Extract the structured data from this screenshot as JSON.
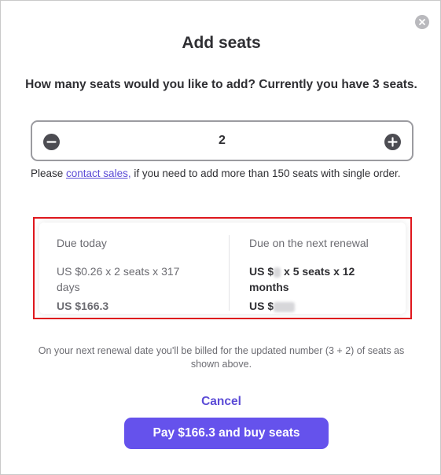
{
  "dialog": {
    "title": "Add seats",
    "question": "How many seats would you like to add? Currently you have 3 seats.",
    "stepper": {
      "value": "2"
    },
    "note": {
      "prefix": "Please ",
      "link": "contact sales,",
      "suffix": " if you need to add more than 150 seats with single order."
    },
    "summary": {
      "due_today": {
        "heading": "Due today",
        "calculation": "US $0.26 x 2 seats x 317 days",
        "total": "US $166.3"
      },
      "next_renewal": {
        "heading": "Due on the next renewal",
        "calc_prefix": "US $",
        "calc_suffix": " x 5 seats x 12 months",
        "total_prefix": "US $"
      }
    },
    "billing_note": "On your next renewal date you'll be billed for the updated number (3 + 2) of seats as shown above.",
    "cancel_label": "Cancel",
    "pay_label": "Pay $166.3 and buy seats"
  },
  "colors": {
    "accent": "#6552ec",
    "link": "#5b4bd6",
    "highlight_border": "#e0181e",
    "text": "#2f2f33",
    "muted": "#6c6c72"
  },
  "icons": {
    "close": "close-icon",
    "minus": "minus-icon",
    "plus": "plus-icon"
  }
}
